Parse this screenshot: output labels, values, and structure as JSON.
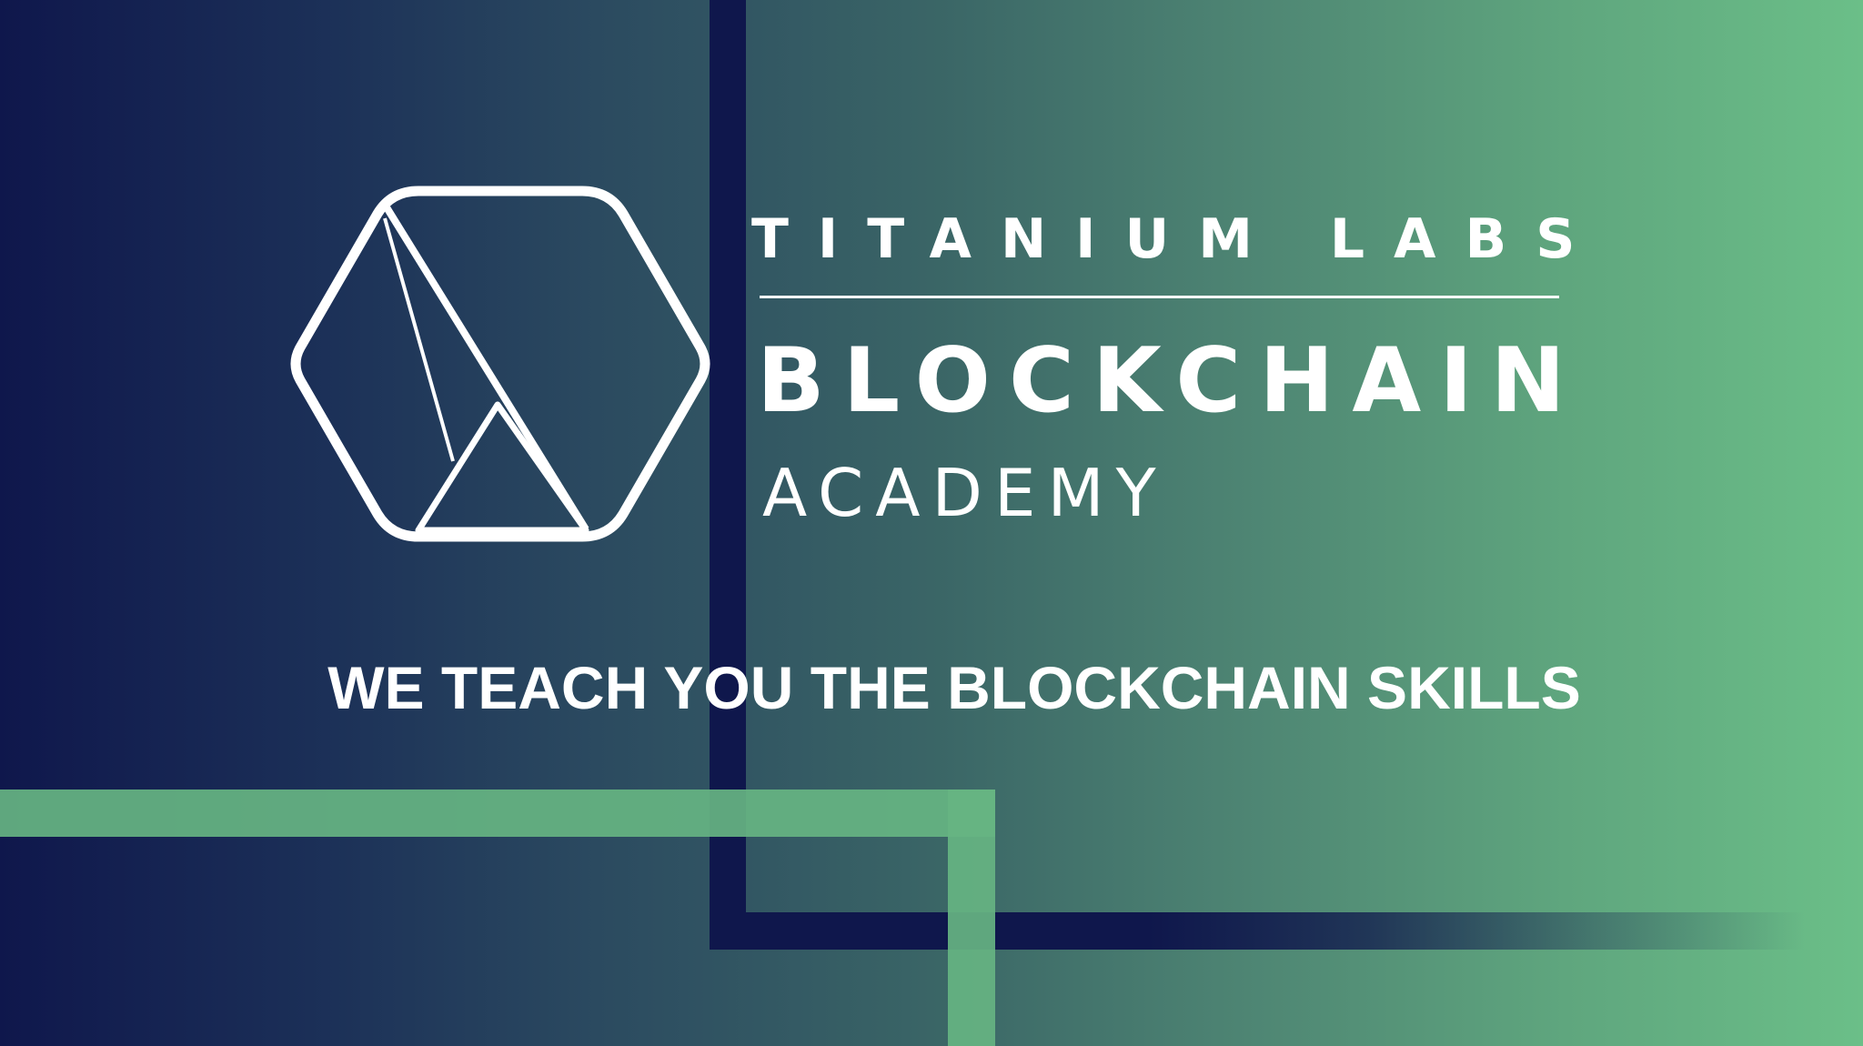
{
  "brand": {
    "company": "TITANIUM LABS",
    "title": "BLOCKCHAIN",
    "subtitle": "ACADEMY",
    "logo_icon": "hexagon-logo-icon"
  },
  "tagline": "WE TEACH YOU THE BLOCKCHAIN SKILLS",
  "colors": {
    "navy": "#0f174c",
    "green": "#66b482",
    "text": "#ffffff"
  }
}
